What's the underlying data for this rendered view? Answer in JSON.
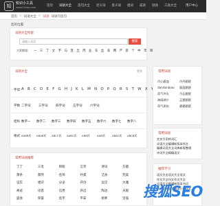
{
  "topbar": {
    "logo_glyph": "知",
    "logo_title": "知识小工具",
    "logo_subtitle": "www.51tiao.com",
    "nav": [
      "首页",
      "词语大全",
      "造句大全",
      "近义词",
      "反义词",
      "组词",
      "成语",
      "谜语",
      "工具大全"
    ],
    "user": "用户中心"
  },
  "breadcrumb": {
    "home": "首页",
    "section": "词语大全",
    "sep": ">",
    "current": "词语",
    "current2": "词语句造句"
  },
  "location": "您的位置:",
  "search_card": {
    "title": "词语大全检索",
    "placeholder": "请输入词语",
    "button": "搜索",
    "index_label": "大家都搜:",
    "index_chars": [
      "一",
      "三",
      "丁",
      "丈",
      "不",
      "与",
      "且",
      "丘",
      "丙",
      "业",
      "东",
      "丝",
      "丢",
      "两",
      "严",
      "丧",
      "个",
      "中",
      "丰",
      "串"
    ]
  },
  "browse_card": {
    "title": "词语大全",
    "more": "更多",
    "rows": [
      {
        "label": "字母",
        "items": [
          "A",
          "B",
          "C",
          "D",
          "E",
          "F",
          "G",
          "H",
          "J",
          "K",
          "L",
          "M",
          "N",
          "O",
          "P",
          "Q",
          "R",
          "S",
          "T",
          "W",
          "X",
          "Y",
          "Z"
        ]
      },
      {
        "label": "字数",
        "items": [
          "二字词",
          "三字词",
          "四字词",
          "五字词",
          "六字词"
        ]
      },
      {
        "label": "结构",
        "items": [
          "数字一",
          "数字二",
          "数字三",
          "数字四",
          "数字五",
          "数字六",
          "数字七",
          "数字八",
          "数字九"
        ]
      },
      {
        "label": "格式",
        "items": [
          "AABB式",
          "ABAB式",
          "ABCC式",
          "AABC式",
          "ABB式",
          "AAB式",
          "ABAC式",
          "ABCB式",
          "ABCA式"
        ]
      }
    ]
  },
  "hot_card": {
    "title": "常用词语推荐",
    "words": [
      "丁丁",
      "三毛",
      "目眩",
      "言笑",
      "诗词",
      "方圆",
      "萧条",
      "骤然",
      "名师",
      "约束",
      "洁身",
      "完美",
      "证实",
      "相识",
      "分泌",
      "开创",
      "远见",
      "大雅",
      "奇迹",
      "讯息",
      "信用",
      "开启",
      "陶冶",
      "天赋",
      "盛会",
      "荣誉",
      "名字",
      "平安",
      "修养",
      "坚强"
    ]
  },
  "side1": {
    "title": "常用词语",
    "items": [
      "丹心碧血",
      "丹丹碧碧",
      "dandanbiao",
      "面面碧碧",
      "奇气冲天",
      "乃石碧碧",
      "海阔湖少",
      "正碧碧碧",
      "奇气发化",
      "碧碧碧碧"
    ]
  },
  "side2": {
    "title": "常用词语",
    "items": [
      "交叉引用的词汇",
      "词语大全编辑新版本所言",
      "编辑词语大全词典新版整理",
      "诗词大全精编语文"
    ]
  },
  "side3": {
    "title": "推荐学习",
    "items": [
      "语文大全语文大全语文",
      "作文大全作文作文大全",
      "词语大全编辑新版本书词",
      "汉语字典全文阅读小学语文"
    ]
  },
  "watermark": {
    "text": "搜狐SEO",
    "badge": "搜"
  },
  "colors": {
    "accent": "#c0392b",
    "button": "#e74c3c",
    "topbar": "#2b2b2b",
    "watermark": "#2a7de1"
  }
}
